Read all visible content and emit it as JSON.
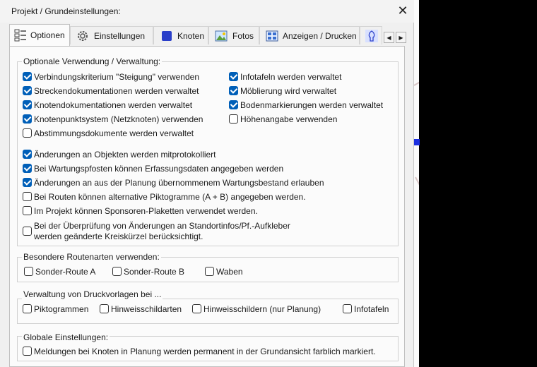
{
  "window": {
    "title": "Projekt / Grundeinstellungen:",
    "close_glyph": "✕"
  },
  "tabs": [
    {
      "label": "Optionen",
      "icon": "options-list-icon"
    },
    {
      "label": "Einstellungen",
      "icon": "gear-icon"
    },
    {
      "label": "Knoten",
      "icon": "node-square-icon"
    },
    {
      "label": "Fotos",
      "icon": "photo-icon"
    },
    {
      "label": "Anzeigen / Drucken",
      "icon": "print-view-icon"
    },
    {
      "label": "",
      "icon": "tree-icon"
    }
  ],
  "tab_nav": {
    "prev": "◀",
    "next": "▶"
  },
  "groups": {
    "optional": {
      "title": "Optionale Verwendung / Verwaltung:",
      "left": [
        {
          "label": "Verbindungskriterium \"Steigung\" verwenden",
          "checked": true
        },
        {
          "label": "Streckendokumentationen werden verwaltet",
          "checked": true
        },
        {
          "label": "Knotendokumentationen werden verwaltet",
          "checked": true
        },
        {
          "label": "Knotenpunktsystem (Netzknoten) verwenden",
          "checked": true
        },
        {
          "label": "Abstimmungsdokumente werden verwaltet",
          "checked": false
        }
      ],
      "right": [
        {
          "label": "Infotafeln werden verwaltet",
          "checked": true
        },
        {
          "label": "Möblierung wird verwaltet",
          "checked": true
        },
        {
          "label": "Bodenmarkierungen werden verwaltet",
          "checked": true
        },
        {
          "label": "Höhenangabe verwenden",
          "checked": false
        }
      ],
      "more": [
        {
          "label": "Änderungen an Objekten werden mitprotokolliert",
          "checked": true
        },
        {
          "label": "Bei Wartungspfosten können Erfassungsdaten angegeben werden",
          "checked": true
        },
        {
          "label": "Änderungen an aus der Planung übernommenem Wartungsbestand erlauben",
          "checked": true
        },
        {
          "label": "Bei Routen können alternative Piktogramme (A + B) angegeben werden.",
          "checked": false
        },
        {
          "label": "Im Projekt können Sponsoren-Plaketten verwendet werden.",
          "checked": false
        }
      ],
      "multiline": {
        "line1": "Bei der Überprüfung von Änderungen an Standortinfos/Pf.-Aufkleber",
        "line2": "werden geänderte Kreiskürzel berücksichtigt.",
        "checked": false
      }
    },
    "routes": {
      "title": "Besondere Routenarten verwenden:",
      "items": [
        {
          "label": "Sonder-Route A",
          "checked": false
        },
        {
          "label": "Sonder-Route B",
          "checked": false
        },
        {
          "label": "Waben",
          "checked": false
        }
      ]
    },
    "print": {
      "title": "Verwaltung von Druckvorlagen bei ...",
      "items": [
        {
          "label": "Piktogrammen",
          "checked": false
        },
        {
          "label": "Hinweisschildarten",
          "checked": false
        },
        {
          "label": "Hinweisschildern (nur Planung)",
          "checked": false
        },
        {
          "label": "Infotafeln",
          "checked": false
        }
      ]
    },
    "global": {
      "title": "Globale Einstellungen:",
      "items": [
        {
          "label": "Meldungen bei Knoten in Planung werden permanent in der Grundansicht farblich markiert.",
          "checked": false
        }
      ]
    }
  },
  "colors": {
    "accent": "#005fb8",
    "background_marker": "#1b2fe0"
  }
}
